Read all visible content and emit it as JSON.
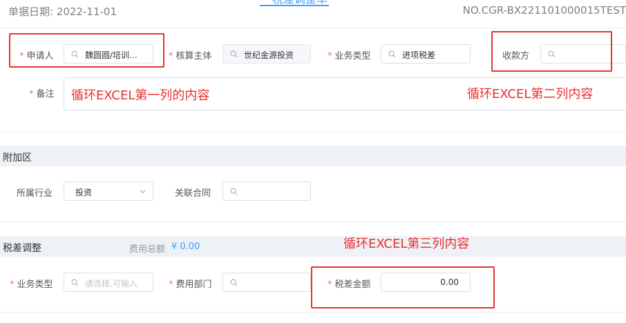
{
  "header": {
    "date_label": "单据日期: 2022-11-01",
    "title": "一税差调整单",
    "doc_no": "NO.CGR-BX221101000015TEST"
  },
  "basic": {
    "applicant": {
      "label": "申请人",
      "value": "魏圆圆/培训…"
    },
    "accounting_entity": {
      "label": "核算主体",
      "value": "世纪金源投资"
    },
    "business_type": {
      "label": "业务类型",
      "value": "进项税差"
    },
    "payee": {
      "label": "收款方",
      "value": ""
    },
    "remark": {
      "label": "备注",
      "value": ""
    }
  },
  "additional": {
    "section_title": "附加区",
    "industry": {
      "label": "所属行业",
      "value": "投资"
    },
    "contract": {
      "label": "关联合同",
      "value": ""
    }
  },
  "tax": {
    "section_title": "税差调整",
    "total_label": "费用总额",
    "total_value": "¥ 0.00",
    "business_type": {
      "label": "业务类型",
      "placeholder": "请选择,可输入"
    },
    "department": {
      "label": "费用部门",
      "value": ""
    },
    "tax_amount": {
      "label": "税差金额",
      "value": "0.00"
    }
  },
  "annotations": {
    "col1": "循环EXCEL第一列的内容",
    "col2": "循环EXCEL第二列内容",
    "col3": "循环EXCEL第三列内容"
  },
  "colors": {
    "required": "#f56c6c",
    "annotation": "#e8302e",
    "accent": "#409eff",
    "section_bg": "#eef1f6"
  }
}
